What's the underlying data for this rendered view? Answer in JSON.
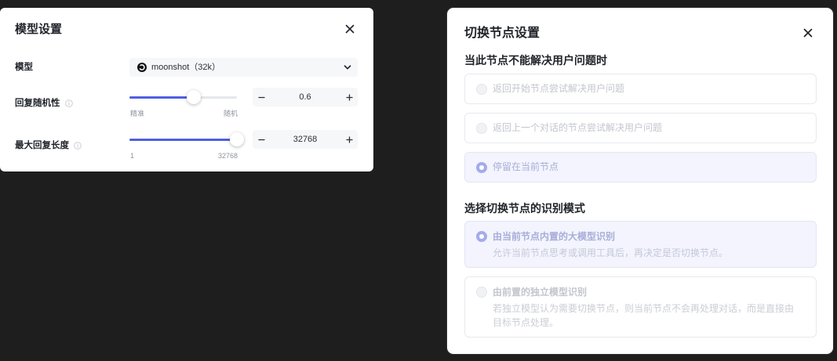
{
  "theme": {
    "background": "#1e1e1e",
    "accent": "#4f5fe3",
    "disabled_text": "#c3c6cd",
    "selected_text": "#a8aed8",
    "selected_background": "#f3f4fd",
    "selected_radio": "#a3abec"
  },
  "model_settings": {
    "title": "模型设置",
    "icons": {
      "close": "close-icon",
      "info": "info-icon",
      "dropdown": "chevron-down-icon",
      "decrease": "minus-icon",
      "increase": "plus-icon"
    },
    "model": {
      "label": "模型",
      "selected": "moonshot（32k）",
      "icon": "moonshot-logo-icon"
    },
    "temperature": {
      "label": "回复随机性",
      "min_label": "精准",
      "max_label": "随机",
      "value": "0.6",
      "slider_level": 0.6
    },
    "max_reply_length": {
      "label": "最大回复长度",
      "min_label": "1",
      "max_label": "32768",
      "value": "32768",
      "slider_level": 1
    }
  },
  "switch_node_settings": {
    "title": "切换节点设置",
    "disabled": true,
    "icons": {
      "close": "close-icon"
    },
    "fallback": {
      "heading": "当此节点不能解决用户问题时",
      "options": [
        {
          "label": "返回开始节点尝试解决用户问题",
          "selected": false
        },
        {
          "label": "返回上一个对话的节点尝试解决用户问题",
          "selected": false
        },
        {
          "label": "停留在当前节点",
          "selected": true
        }
      ]
    },
    "recognition": {
      "heading": "选择切换节点的识别模式",
      "options": [
        {
          "label": "由当前节点内置的大模型识别",
          "description": "允许当前节点思考或调用工具后，再决定是否切换节点。",
          "selected": true
        },
        {
          "label": "由前置的独立模型识别",
          "description": "若独立模型认为需要切换节点，则当前节点不会再处理对话，而是直接由目标节点处理。",
          "selected": false
        }
      ]
    }
  }
}
